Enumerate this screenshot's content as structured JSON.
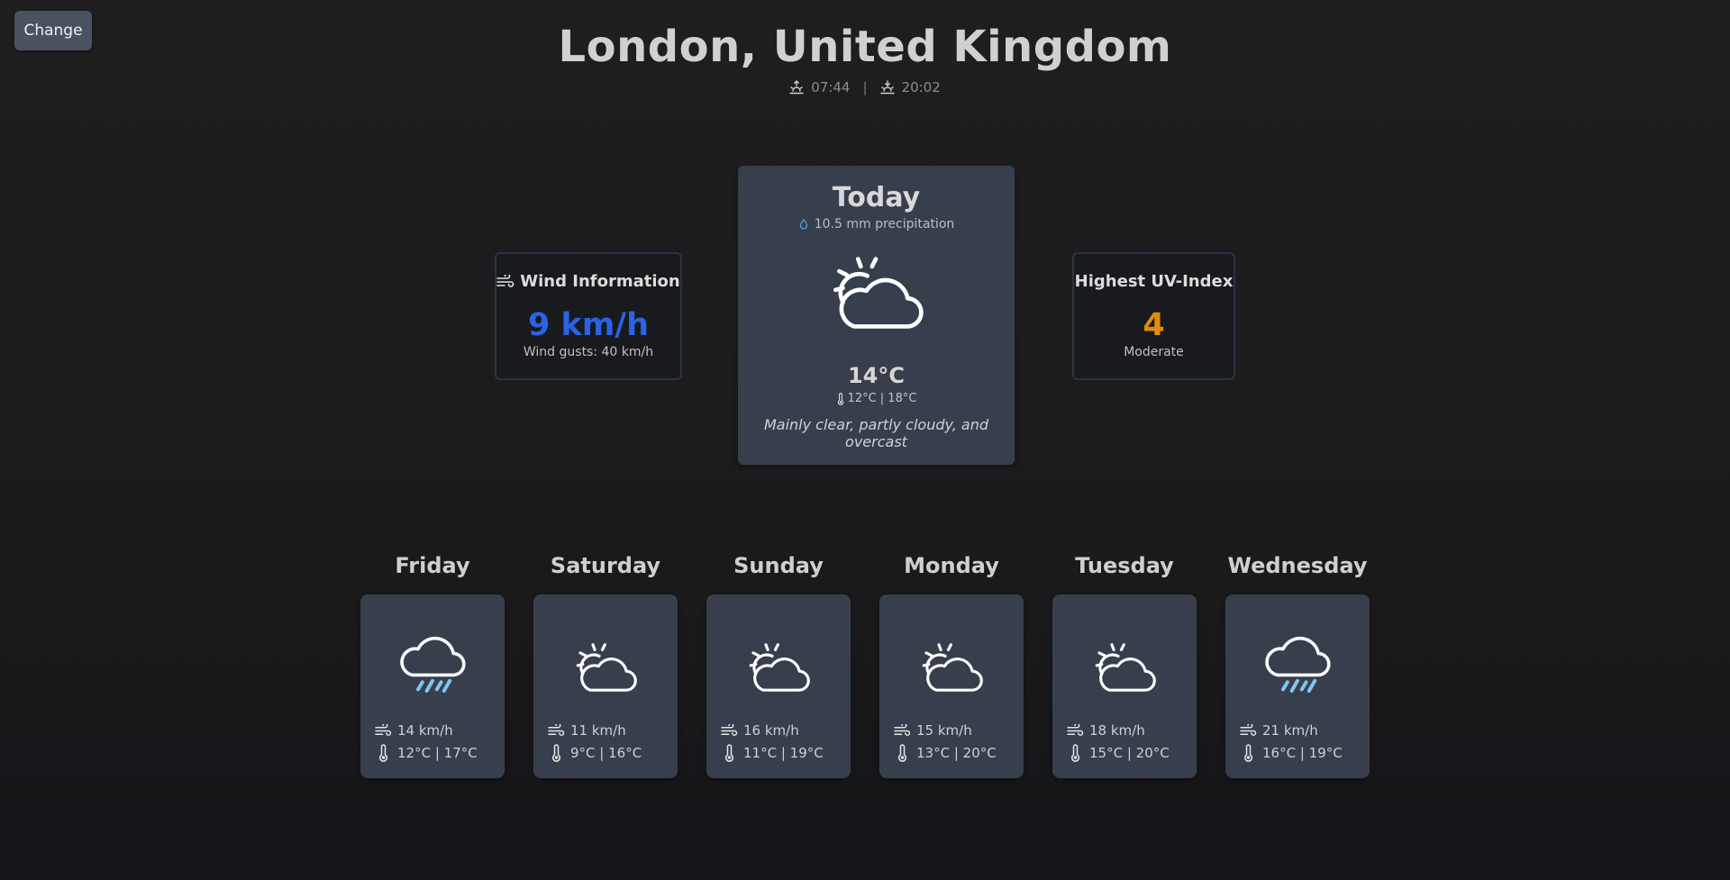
{
  "header": {
    "change_label": "Change",
    "city": "London, United Kingdom",
    "sunrise": "07:44",
    "separator": "|",
    "sunset": "20:02"
  },
  "wind": {
    "title": "Wind Information",
    "speed": "9 km/h",
    "gusts": "Wind gusts: 40 km/h",
    "color": "#2a62e8"
  },
  "today": {
    "title": "Today",
    "precipitation": "10.5 mm precipitation",
    "icon": "partly-cloudy-icon",
    "temp": "14°C",
    "range": "12°C | 18°C",
    "description": "Mainly clear, partly cloudy, and overcast"
  },
  "uv": {
    "title": "Highest UV-Index",
    "value": "4",
    "level": "Moderate",
    "color": "#e08c0c"
  },
  "forecast": [
    {
      "day": "Friday",
      "icon": "rain-cloud-icon",
      "wind": "14 km/h",
      "temp": "12°C | 17°C"
    },
    {
      "day": "Saturday",
      "icon": "partly-cloudy-icon",
      "wind": "11 km/h",
      "temp": "9°C | 16°C"
    },
    {
      "day": "Sunday",
      "icon": "partly-cloudy-icon",
      "wind": "16 km/h",
      "temp": "11°C | 19°C"
    },
    {
      "day": "Monday",
      "icon": "partly-cloudy-icon",
      "wind": "15 km/h",
      "temp": "13°C | 20°C"
    },
    {
      "day": "Tuesday",
      "icon": "partly-cloudy-icon",
      "wind": "18 km/h",
      "temp": "15°C | 20°C"
    },
    {
      "day": "Wednesday",
      "icon": "rain-cloud-icon",
      "wind": "21 km/h",
      "temp": "16°C | 19°C"
    }
  ]
}
